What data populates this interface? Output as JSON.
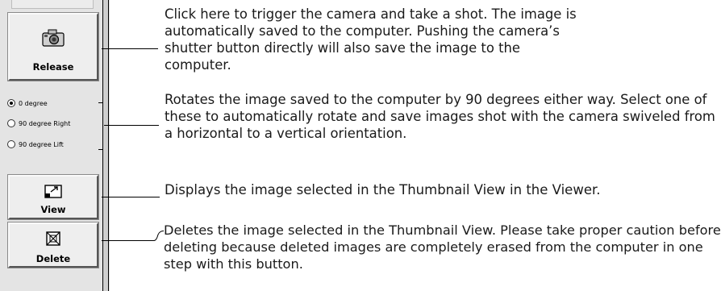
{
  "panel": {
    "release_label": "Release",
    "view_label": "View",
    "delete_label": "Delete",
    "radio_options": [
      {
        "label": "0 degree",
        "checked": true
      },
      {
        "label": "90 degree Right",
        "checked": false
      },
      {
        "label": "90 degree Lift",
        "checked": false
      }
    ]
  },
  "descriptions": {
    "release": "Click here to trigger the camera and take a shot. The image is automatically saved to the computer. Pushing the camera’s shutter button directly will also save the image to the computer.",
    "rotation": "Rotates the image saved to the computer by 90 degrees either way. Select one of these to automatically rotate and save images shot with the camera swiveled from a horizontal to a vertical orientation.",
    "view": "Displays the image selected in the Thumbnail View in the Viewer.",
    "delete": "Deletes the image selected in the Thumbnail View. Please take proper caution before deleting because deleted images are completely erased from the computer in one step with this button."
  },
  "icons": {
    "release": "camera-icon",
    "view": "view-icon",
    "delete": "delete-icon"
  }
}
